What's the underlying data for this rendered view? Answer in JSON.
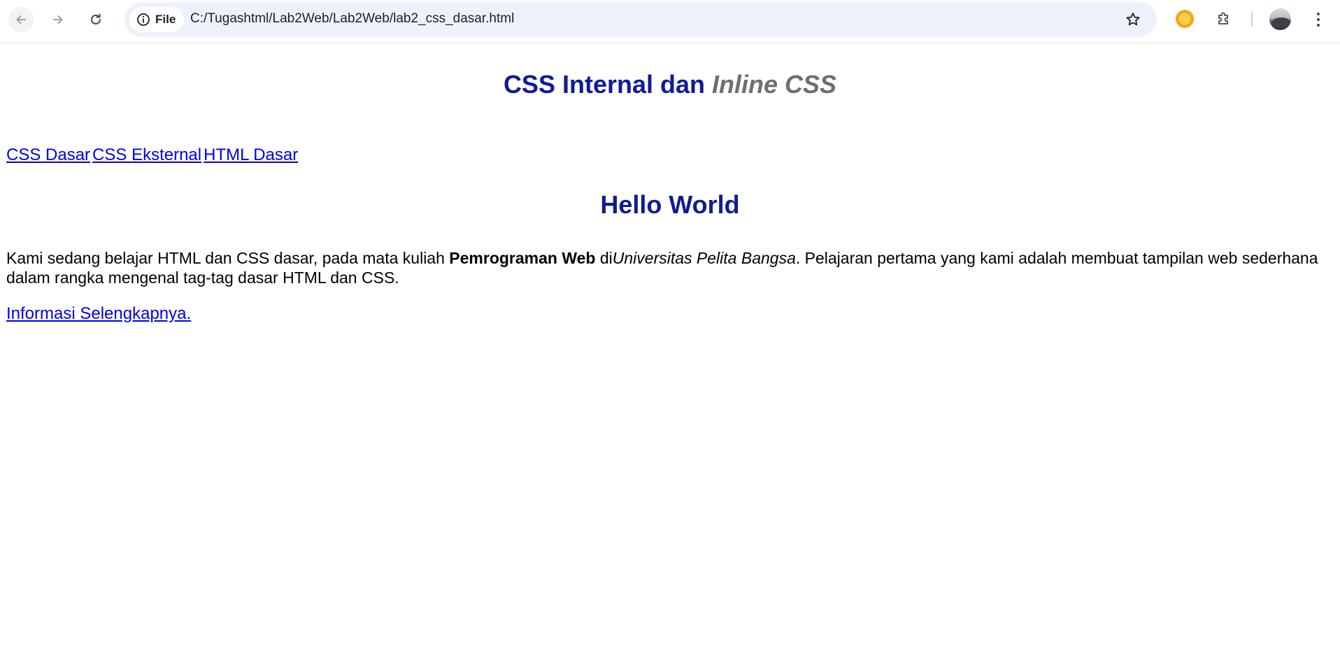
{
  "browser": {
    "address_bar": {
      "scheme_chip": "File",
      "url": "C:/Tugashtml/Lab2Web/Lab2Web/lab2_css_dasar.html"
    },
    "icons": {
      "back": "arrow-left-icon",
      "forward": "arrow-right-icon",
      "reload": "reload-icon",
      "site_info": "info-icon",
      "bookmark": "star-icon",
      "extension": "orange-extension-icon",
      "extensions_menu": "puzzle-icon",
      "profile": "avatar",
      "menu": "kebab-menu-icon"
    }
  },
  "page": {
    "heading": {
      "main": "CSS Internal dan",
      "accent": "Inline CSS"
    },
    "nav_links": [
      {
        "label": "CSS Dasar"
      },
      {
        "label": "CSS Eksternal"
      },
      {
        "label": "HTML Dasar"
      }
    ],
    "hello_title": "Hello World",
    "paragraph": {
      "part1": "Kami sedang belajar HTML dan CSS dasar, pada mata kuliah ",
      "bold": "Pemrograman Web",
      "part2": " di",
      "italic": "Universitas Pelita Bangsa",
      "part3": ". Pelajaran pertama yang kami adalah membuat tampilan web sederhana dalam rangka mengenal tag-tag dasar HTML dan CSS."
    },
    "more_link": "Informasi Selengkapnya."
  },
  "colors": {
    "heading": "#0f1c94",
    "accent_heading": "#6f6f6f",
    "link": "#0000ee",
    "omnibox_bg": "#edf2fa"
  }
}
